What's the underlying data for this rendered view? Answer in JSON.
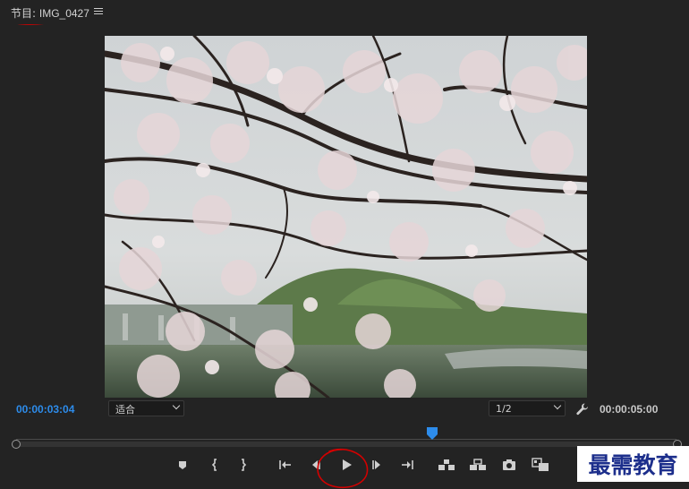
{
  "panel": {
    "title_prefix": "节目: ",
    "title_name": "IMG_0427",
    "menu_icon": "hamburger-menu-icon"
  },
  "viewer": {
    "frame_subject": "cherry-blossom-photo"
  },
  "timecodes": {
    "current": "00:00:03:04",
    "duration": "00:00:05:00",
    "current_color": "#2d8ceb"
  },
  "controls": {
    "fit_value": "适合",
    "resolution_value": "1/2",
    "settings_icon": "wrench-icon"
  },
  "timeline": {
    "playhead_fraction": 0.63
  },
  "transport": [
    {
      "name": "add-marker-button",
      "icon": "marker-icon"
    },
    {
      "name": "mark-in-button",
      "icon": "mark-in-icon"
    },
    {
      "name": "mark-out-button",
      "icon": "mark-out-icon"
    },
    {
      "name": "go-to-in-button",
      "icon": "go-to-in-icon"
    },
    {
      "name": "step-back-button",
      "icon": "step-back-icon"
    },
    {
      "name": "play-button",
      "icon": "play-icon"
    },
    {
      "name": "step-forward-button",
      "icon": "step-forward-icon"
    },
    {
      "name": "go-to-out-button",
      "icon": "go-to-out-icon"
    },
    {
      "name": "lift-button",
      "icon": "lift-icon"
    },
    {
      "name": "extract-button",
      "icon": "extract-icon"
    },
    {
      "name": "export-frame-button",
      "icon": "camera-icon"
    },
    {
      "name": "comparison-view-button",
      "icon": "compare-icon"
    }
  ],
  "watermark": {
    "text": "最需教育",
    "color": "#1d2f8c"
  },
  "annotation_color": "#d40000"
}
